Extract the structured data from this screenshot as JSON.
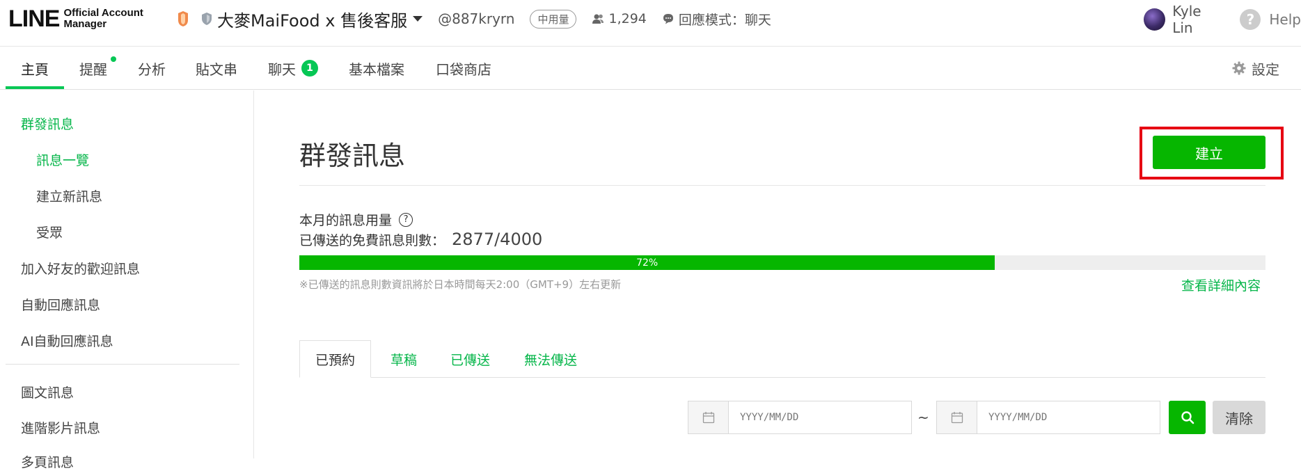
{
  "header": {
    "logo_text": "LINE",
    "logo_sub_1": "Official Account",
    "logo_sub_2": "Manager",
    "account_name": "大麥MaiFood x 售後客服",
    "account_id": "@887kryrn",
    "plan_badge": "中用量",
    "followers": "1,294",
    "response_mode": "回應模式：聊天",
    "user_name": "Kyle Lin",
    "help_label": "Help"
  },
  "nav": {
    "tabs": [
      {
        "label": "主頁",
        "active": true
      },
      {
        "label": "提醒",
        "dot": true
      },
      {
        "label": "分析"
      },
      {
        "label": "貼文串"
      },
      {
        "label": "聊天",
        "badge": "1"
      },
      {
        "label": "基本檔案"
      },
      {
        "label": "口袋商店"
      }
    ],
    "settings_label": "設定"
  },
  "sidebar": {
    "items": [
      {
        "label": "群發訊息"
      },
      {
        "label": "訊息一覽"
      },
      {
        "label": "建立新訊息"
      },
      {
        "label": "受眾"
      },
      {
        "label": "加入好友的歡迎訊息"
      },
      {
        "label": "自動回應訊息"
      },
      {
        "label": "AI自動回應訊息"
      },
      {
        "label": "圖文訊息"
      },
      {
        "label": "進階影片訊息"
      },
      {
        "label": "多頁訊息"
      }
    ]
  },
  "main": {
    "title": "群發訊息",
    "create_button": "建立",
    "usage_label": "本月的訊息用量",
    "sent_label": "已傳送的免費訊息則數：",
    "sent_value": "2877/4000",
    "progress_percent": 72,
    "progress_label": "72%",
    "note": "※已傳送的訊息則數資訊將於日本時間每天2:00（GMT+9）左右更新",
    "details_link": "查看詳細內容",
    "tabs": [
      {
        "label": "已預約",
        "active": true
      },
      {
        "label": "草稿"
      },
      {
        "label": "已傳送"
      },
      {
        "label": "無法傳送"
      }
    ],
    "date_from_placeholder": "YYYY/MM/DD",
    "date_to_placeholder": "YYYY/MM/DD",
    "tilde": "~",
    "clear_button": "清除"
  },
  "colors": {
    "accent": "#06b600",
    "link_green": "#06b64a",
    "highlight_red": "#e60012"
  }
}
